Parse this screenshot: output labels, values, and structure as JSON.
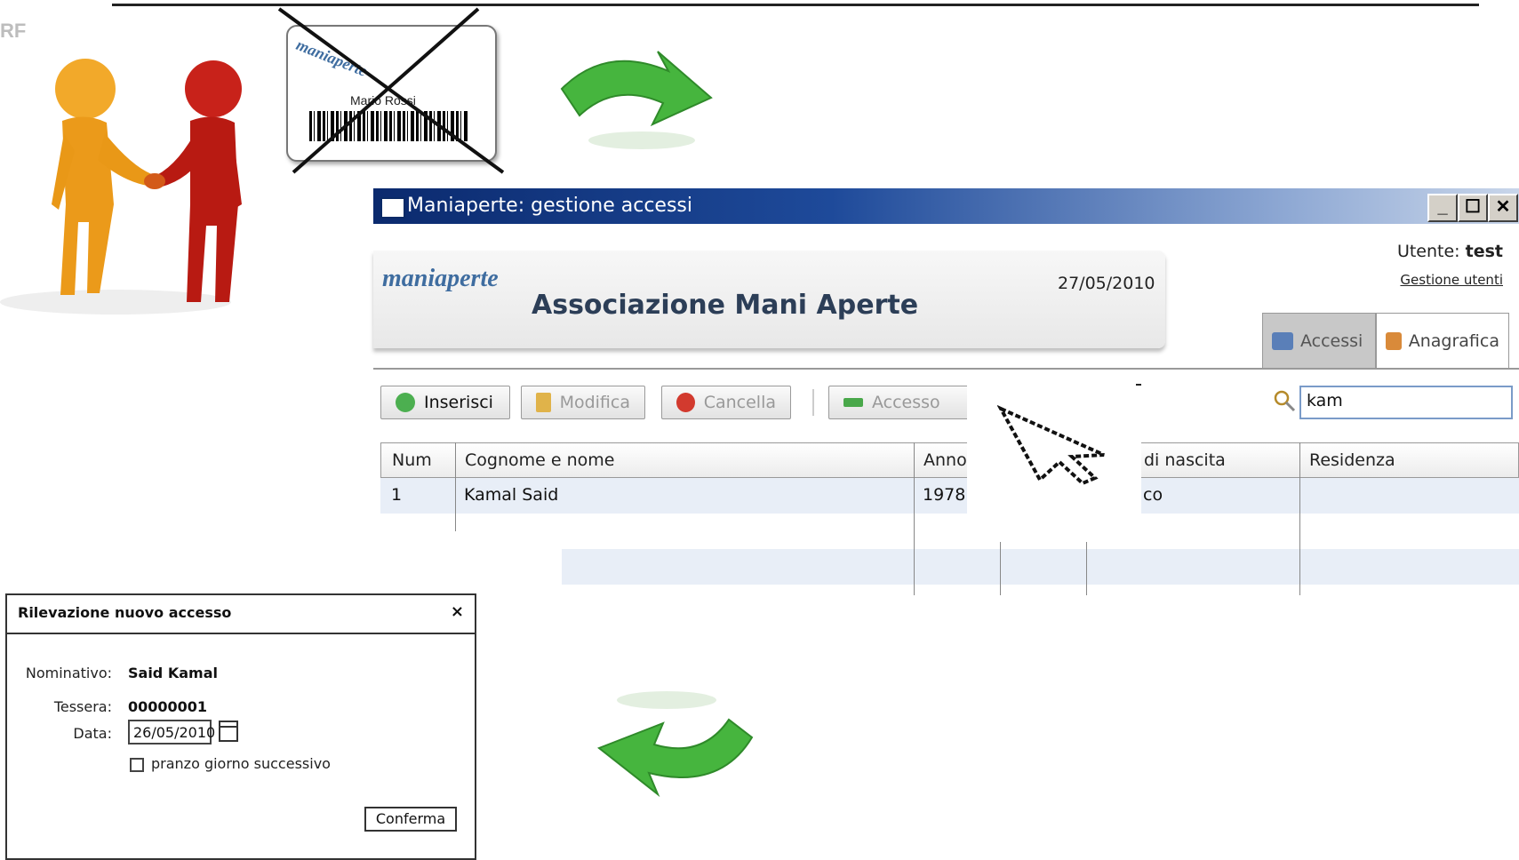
{
  "card": {
    "brand": "maniaperte",
    "name": "Mario Rossi"
  },
  "window": {
    "title": "Maniaperte: gestione accessi",
    "controls": {
      "minimize": "_",
      "maximize": "☐",
      "close": "✕"
    },
    "banner": {
      "brand": "maniaperte",
      "org_name": "Associazione Mani Aperte",
      "date": "27/05/2010"
    },
    "user": {
      "label": "Utente:",
      "name": "test",
      "manage_link": "Gestione utenti"
    },
    "tabs": [
      {
        "label": "Accessi",
        "icon": "book-icon",
        "active": true
      },
      {
        "label": "Anagrafica",
        "icon": "users-icon",
        "active": false
      }
    ],
    "toolbar": {
      "insert": "Inserisci",
      "edit": "Modifica",
      "delete": "Cancella",
      "access": "Accesso"
    },
    "search": {
      "value": "kam"
    },
    "grid": {
      "columns": [
        "Num",
        "Cognome e nome",
        "Anno",
        "di nascita",
        "Residenza"
      ],
      "rows": [
        {
          "num": "1",
          "name": "Kamal Said",
          "year": "1978",
          "birthplace": "co",
          "residence": ""
        }
      ]
    }
  },
  "dialog": {
    "title": "Rilevazione nuovo accesso",
    "close": "×",
    "fields": {
      "nominativo_label": "Nominativo:",
      "nominativo_value": "Said Kamal",
      "tessera_label": "Tessera:",
      "tessera_value": "00000001",
      "data_label": "Data:",
      "data_value": "26/05/2010"
    },
    "checkbox_label": "pranzo giorno successivo",
    "confirm": "Conferma"
  },
  "colors": {
    "accent": "#1e4a9a",
    "arrow": "#3fb33a",
    "figure_yellow": "#f0a21e",
    "figure_red": "#c41d14"
  }
}
